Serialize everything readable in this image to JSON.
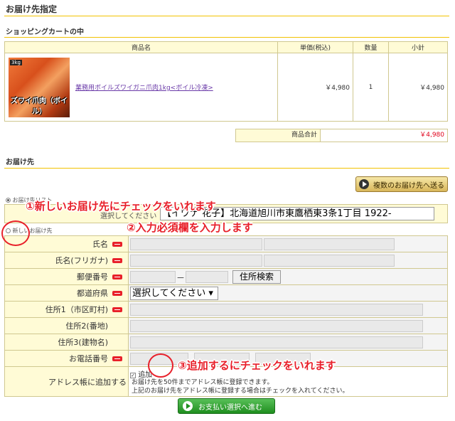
{
  "page_title": "お届け先指定",
  "cart": {
    "section_title": "ショッピングカートの中",
    "headers": [
      "商品名",
      "単価(税込)",
      "数量",
      "小計"
    ],
    "item": {
      "image_badge": "3kg",
      "image_caption": "ズワイ爪肉（ボイル）",
      "name": "業務用ボイルズワイガニ爪肉1kg<ボイル冷凍>",
      "price": "￥4,980",
      "qty": "1",
      "subtotal": "￥4,980"
    },
    "total_label": "商品合計",
    "total_value": "￥4,980"
  },
  "delivery": {
    "section_title": "お届け先",
    "multi_button": "複数のお届け先へ送る",
    "radio_existing_label": "お届け先リスト",
    "existing_select_label": "選択してください",
    "existing_select_value": "【イワナ 花子】北海道旭川市東鷹栖東3条1丁目 1922-",
    "radio_new_label": "新しいお届け先"
  },
  "form": {
    "fields": [
      {
        "label": "氏名"
      },
      {
        "label": "氏名(フリガナ)"
      },
      {
        "label": "郵便番号"
      },
      {
        "label": "都道府県"
      },
      {
        "label": "住所1（市区町村)"
      },
      {
        "label": "住所2(番地)"
      },
      {
        "label": "住所3(建物名)"
      },
      {
        "label": "お電話番号"
      },
      {
        "label": "アドレス帳に追加する"
      }
    ],
    "zip_separator": "－",
    "zip_search": "住所検索",
    "pref_select": "選択してください",
    "addrbook_check_label": "追加",
    "addrbook_note1": "お届け先を50件までアドレス帳に登録できます。",
    "addrbook_note2": "上記のお届け先をアドレス帳に登録する場合はチェックを入れてください。"
  },
  "annotations": {
    "a1": "①新しいお届け先にチェックをいれます",
    "a2": "②入力必須欄を入力します",
    "a3": "③追加するにチェックをいれます"
  },
  "submit_button": "お支払い選択へ進む",
  "colors": {
    "accent_red": "#e8202a",
    "header_yellow": "#fffbd6",
    "rule_gold": "#f2c200",
    "button_green": "#1f8e1f"
  }
}
